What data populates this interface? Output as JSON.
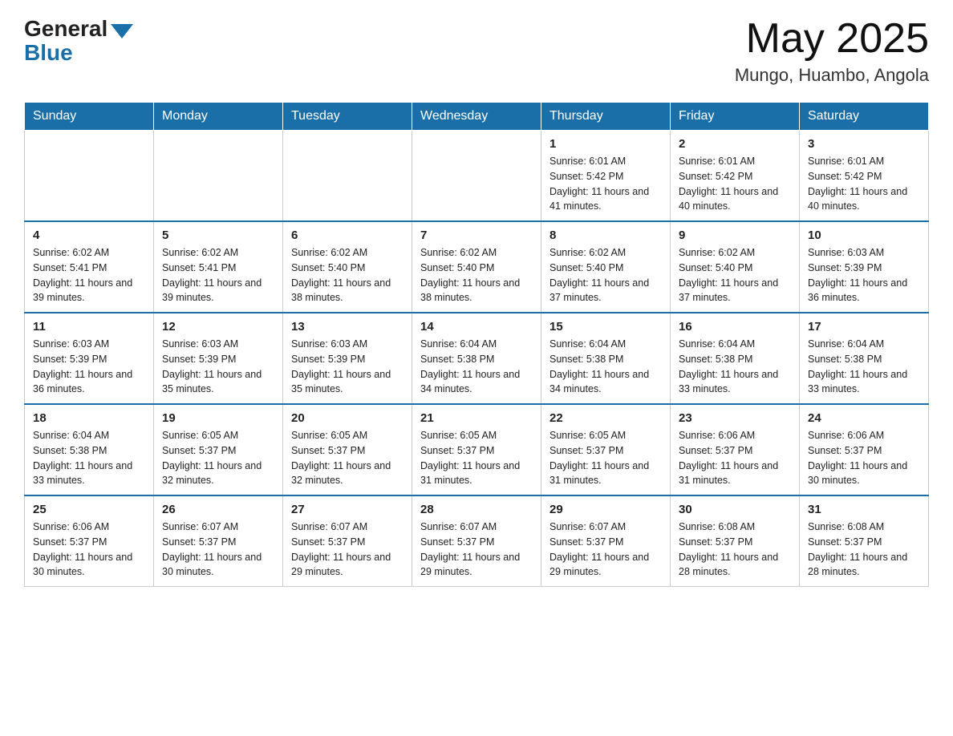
{
  "header": {
    "logo_general": "General",
    "logo_blue": "Blue",
    "title": "May 2025",
    "location": "Mungo, Huambo, Angola"
  },
  "days_of_week": [
    "Sunday",
    "Monday",
    "Tuesday",
    "Wednesday",
    "Thursday",
    "Friday",
    "Saturday"
  ],
  "weeks": [
    [
      {
        "day": "",
        "info": ""
      },
      {
        "day": "",
        "info": ""
      },
      {
        "day": "",
        "info": ""
      },
      {
        "day": "",
        "info": ""
      },
      {
        "day": "1",
        "info": "Sunrise: 6:01 AM\nSunset: 5:42 PM\nDaylight: 11 hours and 41 minutes."
      },
      {
        "day": "2",
        "info": "Sunrise: 6:01 AM\nSunset: 5:42 PM\nDaylight: 11 hours and 40 minutes."
      },
      {
        "day": "3",
        "info": "Sunrise: 6:01 AM\nSunset: 5:42 PM\nDaylight: 11 hours and 40 minutes."
      }
    ],
    [
      {
        "day": "4",
        "info": "Sunrise: 6:02 AM\nSunset: 5:41 PM\nDaylight: 11 hours and 39 minutes."
      },
      {
        "day": "5",
        "info": "Sunrise: 6:02 AM\nSunset: 5:41 PM\nDaylight: 11 hours and 39 minutes."
      },
      {
        "day": "6",
        "info": "Sunrise: 6:02 AM\nSunset: 5:40 PM\nDaylight: 11 hours and 38 minutes."
      },
      {
        "day": "7",
        "info": "Sunrise: 6:02 AM\nSunset: 5:40 PM\nDaylight: 11 hours and 38 minutes."
      },
      {
        "day": "8",
        "info": "Sunrise: 6:02 AM\nSunset: 5:40 PM\nDaylight: 11 hours and 37 minutes."
      },
      {
        "day": "9",
        "info": "Sunrise: 6:02 AM\nSunset: 5:40 PM\nDaylight: 11 hours and 37 minutes."
      },
      {
        "day": "10",
        "info": "Sunrise: 6:03 AM\nSunset: 5:39 PM\nDaylight: 11 hours and 36 minutes."
      }
    ],
    [
      {
        "day": "11",
        "info": "Sunrise: 6:03 AM\nSunset: 5:39 PM\nDaylight: 11 hours and 36 minutes."
      },
      {
        "day": "12",
        "info": "Sunrise: 6:03 AM\nSunset: 5:39 PM\nDaylight: 11 hours and 35 minutes."
      },
      {
        "day": "13",
        "info": "Sunrise: 6:03 AM\nSunset: 5:39 PM\nDaylight: 11 hours and 35 minutes."
      },
      {
        "day": "14",
        "info": "Sunrise: 6:04 AM\nSunset: 5:38 PM\nDaylight: 11 hours and 34 minutes."
      },
      {
        "day": "15",
        "info": "Sunrise: 6:04 AM\nSunset: 5:38 PM\nDaylight: 11 hours and 34 minutes."
      },
      {
        "day": "16",
        "info": "Sunrise: 6:04 AM\nSunset: 5:38 PM\nDaylight: 11 hours and 33 minutes."
      },
      {
        "day": "17",
        "info": "Sunrise: 6:04 AM\nSunset: 5:38 PM\nDaylight: 11 hours and 33 minutes."
      }
    ],
    [
      {
        "day": "18",
        "info": "Sunrise: 6:04 AM\nSunset: 5:38 PM\nDaylight: 11 hours and 33 minutes."
      },
      {
        "day": "19",
        "info": "Sunrise: 6:05 AM\nSunset: 5:37 PM\nDaylight: 11 hours and 32 minutes."
      },
      {
        "day": "20",
        "info": "Sunrise: 6:05 AM\nSunset: 5:37 PM\nDaylight: 11 hours and 32 minutes."
      },
      {
        "day": "21",
        "info": "Sunrise: 6:05 AM\nSunset: 5:37 PM\nDaylight: 11 hours and 31 minutes."
      },
      {
        "day": "22",
        "info": "Sunrise: 6:05 AM\nSunset: 5:37 PM\nDaylight: 11 hours and 31 minutes."
      },
      {
        "day": "23",
        "info": "Sunrise: 6:06 AM\nSunset: 5:37 PM\nDaylight: 11 hours and 31 minutes."
      },
      {
        "day": "24",
        "info": "Sunrise: 6:06 AM\nSunset: 5:37 PM\nDaylight: 11 hours and 30 minutes."
      }
    ],
    [
      {
        "day": "25",
        "info": "Sunrise: 6:06 AM\nSunset: 5:37 PM\nDaylight: 11 hours and 30 minutes."
      },
      {
        "day": "26",
        "info": "Sunrise: 6:07 AM\nSunset: 5:37 PM\nDaylight: 11 hours and 30 minutes."
      },
      {
        "day": "27",
        "info": "Sunrise: 6:07 AM\nSunset: 5:37 PM\nDaylight: 11 hours and 29 minutes."
      },
      {
        "day": "28",
        "info": "Sunrise: 6:07 AM\nSunset: 5:37 PM\nDaylight: 11 hours and 29 minutes."
      },
      {
        "day": "29",
        "info": "Sunrise: 6:07 AM\nSunset: 5:37 PM\nDaylight: 11 hours and 29 minutes."
      },
      {
        "day": "30",
        "info": "Sunrise: 6:08 AM\nSunset: 5:37 PM\nDaylight: 11 hours and 28 minutes."
      },
      {
        "day": "31",
        "info": "Sunrise: 6:08 AM\nSunset: 5:37 PM\nDaylight: 11 hours and 28 minutes."
      }
    ]
  ]
}
